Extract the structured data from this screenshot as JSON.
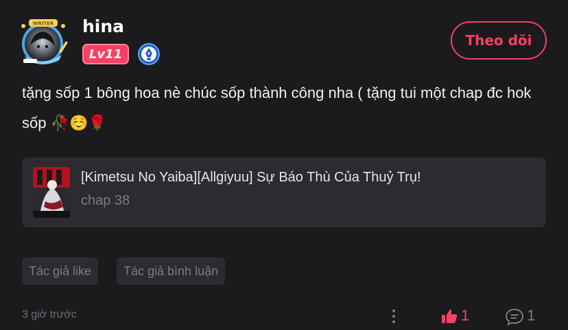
{
  "user": {
    "name": "hina",
    "level": "Lv11",
    "follow_label": "Theo dõi"
  },
  "comment": {
    "text": "tặng sốp 1 bông hoa nè chúc sốp thành công nha ( tặng tui một chap đc hok sốp",
    "emojis": "🥀☺️🌹"
  },
  "chapter_card": {
    "title": "[Kimetsu No Yaiba][Allgiyuu] Sự Báo Thù Của Thuỷ Trụ!",
    "chapter": "chap 38"
  },
  "tags": [
    "Tác giả like",
    "Tác giả bình luận"
  ],
  "footer": {
    "time": "3 giờ trước",
    "like_count": "1",
    "reply_count": "1"
  },
  "colors": {
    "accent": "#fb3f64",
    "background": "#1b1a1d",
    "card": "#2c2b2f",
    "muted": "#7c7b80"
  },
  "icons": {
    "avatar_badge": "WRITER",
    "writer": "pen-nib-icon",
    "more": "more-vertical-icon",
    "like": "thumbs-up-icon",
    "reply": "comment-bubble-icon"
  }
}
